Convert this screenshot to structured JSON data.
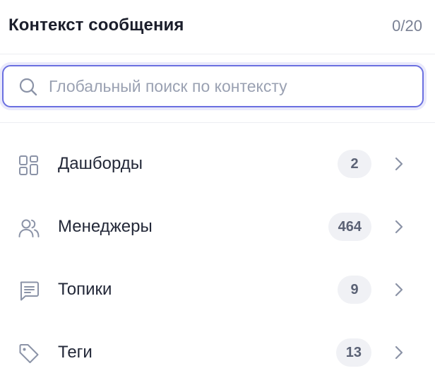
{
  "header": {
    "title": "Контекст сообщения",
    "count": "0/20"
  },
  "search": {
    "placeholder": "Глобальный поиск по контексту",
    "value": "",
    "icon": "search-icon"
  },
  "items": [
    {
      "label": "Дашборды",
      "count": "2",
      "icon": "dashboard-icon"
    },
    {
      "label": "Менеджеры",
      "count": "464",
      "icon": "users-icon"
    },
    {
      "label": "Топики",
      "count": "9",
      "icon": "message-icon"
    },
    {
      "label": "Теги",
      "count": "13",
      "icon": "tag-icon"
    }
  ],
  "colors": {
    "accent": "#6a6fe0",
    "text": "#1b1e2b",
    "muted": "#7a8194",
    "badge_bg": "#f0f1f5",
    "icon": "#8b93a7"
  }
}
